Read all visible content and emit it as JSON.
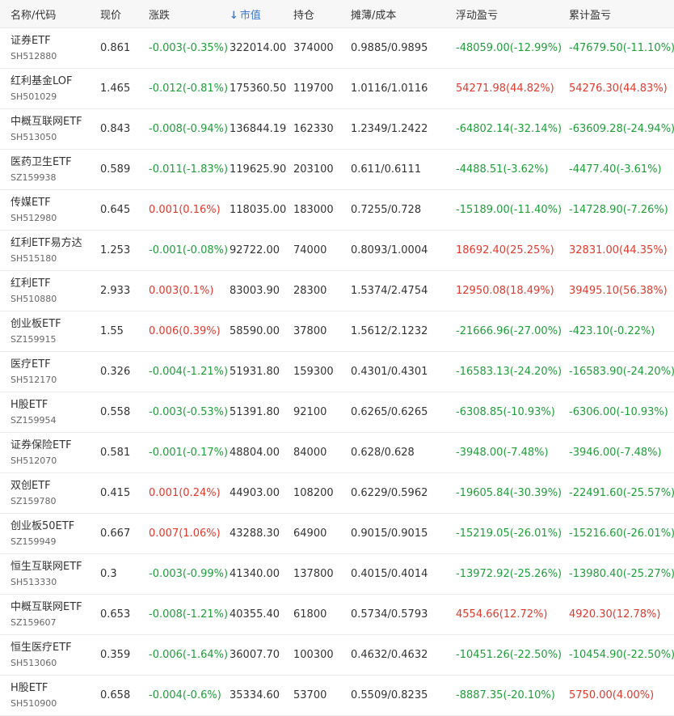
{
  "columns": {
    "name": "名称/代码",
    "price": "现价",
    "change": "涨跌",
    "market_value": "市值",
    "position": "持仓",
    "cost": "摊薄/成本",
    "float_pnl": "浮动盈亏",
    "cum_pnl": "累计盈亏",
    "sort_icon": "↓"
  },
  "colors": {
    "up": "#e03a2e",
    "down": "#1f9e3a",
    "accent": "#3a7bd5"
  },
  "rows": [
    {
      "name": "证券ETF",
      "code": "SH512880",
      "price": "0.861",
      "change": "-0.003(-0.35%)",
      "mv": "322014.00",
      "pos": "374000",
      "cost": "0.9885/0.9895",
      "float": "-48059.00(-12.99%)",
      "cum": "-47679.50(-11.10%)"
    },
    {
      "name": "红利基金LOF",
      "code": "SH501029",
      "price": "1.465",
      "change": "-0.012(-0.81%)",
      "mv": "175360.50",
      "pos": "119700",
      "cost": "1.0116/1.0116",
      "float": "54271.98(44.82%)",
      "cum": "54276.30(44.83%)"
    },
    {
      "name": "中概互联网ETF",
      "code": "SH513050",
      "price": "0.843",
      "change": "-0.008(-0.94%)",
      "mv": "136844.19",
      "pos": "162330",
      "cost": "1.2349/1.2422",
      "float": "-64802.14(-32.14%)",
      "cum": "-63609.28(-24.94%)"
    },
    {
      "name": "医药卫生ETF",
      "code": "SZ159938",
      "price": "0.589",
      "change": "-0.011(-1.83%)",
      "mv": "119625.90",
      "pos": "203100",
      "cost": "0.611/0.6111",
      "float": "-4488.51(-3.62%)",
      "cum": "-4477.40(-3.61%)"
    },
    {
      "name": "传媒ETF",
      "code": "SH512980",
      "price": "0.645",
      "change": "0.001(0.16%)",
      "mv": "118035.00",
      "pos": "183000",
      "cost": "0.7255/0.728",
      "float": "-15189.00(-11.40%)",
      "cum": "-14728.90(-7.26%)"
    },
    {
      "name": "红利ETF易方达",
      "code": "SH515180",
      "price": "1.253",
      "change": "-0.001(-0.08%)",
      "mv": "92722.00",
      "pos": "74000",
      "cost": "0.8093/1.0004",
      "float": "18692.40(25.25%)",
      "cum": "32831.00(44.35%)"
    },
    {
      "name": "红利ETF",
      "code": "SH510880",
      "price": "2.933",
      "change": "0.003(0.1%)",
      "mv": "83003.90",
      "pos": "28300",
      "cost": "1.5374/2.4754",
      "float": "12950.08(18.49%)",
      "cum": "39495.10(56.38%)"
    },
    {
      "name": "创业板ETF",
      "code": "SZ159915",
      "price": "1.55",
      "change": "0.006(0.39%)",
      "mv": "58590.00",
      "pos": "37800",
      "cost": "1.5612/2.1232",
      "float": "-21666.96(-27.00%)",
      "cum": "-423.10(-0.22%)"
    },
    {
      "name": "医疗ETF",
      "code": "SH512170",
      "price": "0.326",
      "change": "-0.004(-1.21%)",
      "mv": "51931.80",
      "pos": "159300",
      "cost": "0.4301/0.4301",
      "float": "-16583.13(-24.20%)",
      "cum": "-16583.90(-24.20%)"
    },
    {
      "name": "H股ETF",
      "code": "SZ159954",
      "price": "0.558",
      "change": "-0.003(-0.53%)",
      "mv": "51391.80",
      "pos": "92100",
      "cost": "0.6265/0.6265",
      "float": "-6308.85(-10.93%)",
      "cum": "-6306.00(-10.93%)"
    },
    {
      "name": "证券保险ETF",
      "code": "SH512070",
      "price": "0.581",
      "change": "-0.001(-0.17%)",
      "mv": "48804.00",
      "pos": "84000",
      "cost": "0.628/0.628",
      "float": "-3948.00(-7.48%)",
      "cum": "-3946.00(-7.48%)"
    },
    {
      "name": "双创ETF",
      "code": "SZ159780",
      "price": "0.415",
      "change": "0.001(0.24%)",
      "mv": "44903.00",
      "pos": "108200",
      "cost": "0.6229/0.5962",
      "float": "-19605.84(-30.39%)",
      "cum": "-22491.60(-25.57%)"
    },
    {
      "name": "创业板50ETF",
      "code": "SZ159949",
      "price": "0.667",
      "change": "0.007(1.06%)",
      "mv": "43288.30",
      "pos": "64900",
      "cost": "0.9015/0.9015",
      "float": "-15219.05(-26.01%)",
      "cum": "-15216.60(-26.01%)"
    },
    {
      "name": "恒生互联网ETF",
      "code": "SH513330",
      "price": "0.3",
      "change": "-0.003(-0.99%)",
      "mv": "41340.00",
      "pos": "137800",
      "cost": "0.4015/0.4014",
      "float": "-13972.92(-25.26%)",
      "cum": "-13980.40(-25.27%)"
    },
    {
      "name": "中概互联网ETF",
      "code": "SZ159607",
      "price": "0.653",
      "change": "-0.008(-1.21%)",
      "mv": "40355.40",
      "pos": "61800",
      "cost": "0.5734/0.5793",
      "float": "4554.66(12.72%)",
      "cum": "4920.30(12.78%)"
    },
    {
      "name": "恒生医疗ETF",
      "code": "SH513060",
      "price": "0.359",
      "change": "-0.006(-1.64%)",
      "mv": "36007.70",
      "pos": "100300",
      "cost": "0.4632/0.4632",
      "float": "-10451.26(-22.50%)",
      "cum": "-10454.90(-22.50%)"
    },
    {
      "name": "H股ETF",
      "code": "SH510900",
      "price": "0.658",
      "change": "-0.004(-0.6%)",
      "mv": "35334.60",
      "pos": "53700",
      "cost": "0.5509/0.8235",
      "float": "-8887.35(-20.10%)",
      "cum": "5750.00(4.00%)"
    }
  ]
}
